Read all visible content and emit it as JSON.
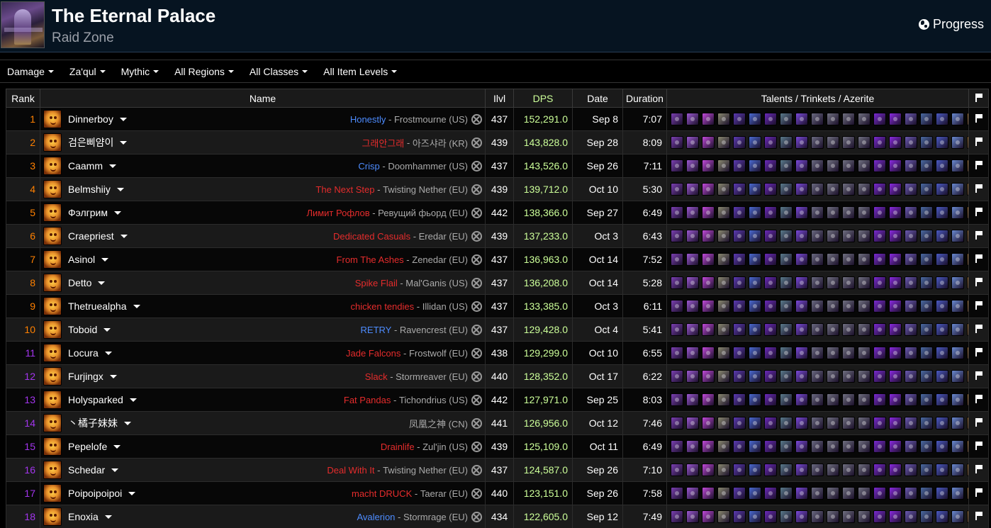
{
  "header": {
    "title": "The Eternal Palace",
    "subtitle": "Raid Zone",
    "progress_label": "Progress"
  },
  "filters": [
    {
      "label": "Damage"
    },
    {
      "label": "Za'qul"
    },
    {
      "label": "Mythic"
    },
    {
      "label": "All Regions"
    },
    {
      "label": "All Classes"
    },
    {
      "label": "All Item Levels"
    }
  ],
  "table": {
    "headers": {
      "rank": "Rank",
      "name": "Name",
      "ilvl": "Ilvl",
      "dps": "DPS",
      "date": "Date",
      "duration": "Duration",
      "talents": "Talents / Trinkets / Azerite"
    },
    "rank_colors": {
      "orange": "#ff8000",
      "purple": "#a335ee"
    },
    "guild_colors": {
      "red": "#e52c2c",
      "blue": "#4d8cff"
    },
    "rows": [
      {
        "rank": "1",
        "rank_color": "#ff8000",
        "name": "Dinnerboy",
        "guild": "Honestly",
        "guild_color": "#4d8cff",
        "realm": "Frostmourne (US)",
        "ilvl": "437",
        "dps": "152,291.0",
        "date": "Sep 8",
        "duration": "7:07"
      },
      {
        "rank": "2",
        "rank_color": "#ff8000",
        "name": "검은삐얌이",
        "guild": "그래안그래",
        "guild_color": "#e52c2c",
        "realm": "아즈샤라 (KR)",
        "ilvl": "439",
        "dps": "143,828.0",
        "date": "Sep 28",
        "duration": "8:09"
      },
      {
        "rank": "3",
        "rank_color": "#ff8000",
        "name": "Caamm",
        "guild": "Crisp",
        "guild_color": "#4d8cff",
        "realm": "Doomhammer (US)",
        "ilvl": "437",
        "dps": "143,526.0",
        "date": "Sep 26",
        "duration": "7:11"
      },
      {
        "rank": "4",
        "rank_color": "#ff8000",
        "name": "Belmshiiy",
        "guild": "The Next Step",
        "guild_color": "#e52c2c",
        "realm": "Twisting Nether (EU)",
        "ilvl": "439",
        "dps": "139,712.0",
        "date": "Oct 10",
        "duration": "5:30"
      },
      {
        "rank": "5",
        "rank_color": "#ff8000",
        "name": "Фэлгрим",
        "guild": "Лимит Рофлов",
        "guild_color": "#e52c2c",
        "realm": "Ревущий фьорд (EU)",
        "ilvl": "442",
        "dps": "138,366.0",
        "date": "Sep 27",
        "duration": "6:49"
      },
      {
        "rank": "6",
        "rank_color": "#ff8000",
        "name": "Craepriest",
        "guild": "Dedicated Casuals",
        "guild_color": "#e52c2c",
        "realm": "Eredar (EU)",
        "ilvl": "439",
        "dps": "137,233.0",
        "date": "Oct 3",
        "duration": "6:43"
      },
      {
        "rank": "7",
        "rank_color": "#ff8000",
        "name": "Asinol",
        "guild": "From The Ashes",
        "guild_color": "#e52c2c",
        "realm": "Zenedar (EU)",
        "ilvl": "437",
        "dps": "136,963.0",
        "date": "Oct 14",
        "duration": "7:52"
      },
      {
        "rank": "8",
        "rank_color": "#ff8000",
        "name": "Detto",
        "guild": "Spike Flail",
        "guild_color": "#e52c2c",
        "realm": "Mal'Ganis (US)",
        "ilvl": "437",
        "dps": "136,208.0",
        "date": "Oct 14",
        "duration": "5:28"
      },
      {
        "rank": "9",
        "rank_color": "#ff8000",
        "name": "Thetruealpha",
        "guild": "chicken tendies",
        "guild_color": "#e52c2c",
        "realm": "Illidan (US)",
        "ilvl": "437",
        "dps": "133,385.0",
        "date": "Oct 3",
        "duration": "6:11"
      },
      {
        "rank": "10",
        "rank_color": "#ff8000",
        "name": "Toboid",
        "guild": "RETRY",
        "guild_color": "#4d8cff",
        "realm": "Ravencrest (EU)",
        "ilvl": "437",
        "dps": "129,428.0",
        "date": "Oct 4",
        "duration": "5:41"
      },
      {
        "rank": "11",
        "rank_color": "#a335ee",
        "name": "Locura",
        "guild": "Jade Falcons",
        "guild_color": "#e52c2c",
        "realm": "Frostwolf (EU)",
        "ilvl": "438",
        "dps": "129,299.0",
        "date": "Oct 10",
        "duration": "6:55"
      },
      {
        "rank": "12",
        "rank_color": "#a335ee",
        "name": "Furjingx",
        "guild": "Slack",
        "guild_color": "#e52c2c",
        "realm": "Stormreaver (EU)",
        "ilvl": "440",
        "dps": "128,352.0",
        "date": "Oct 17",
        "duration": "6:22"
      },
      {
        "rank": "13",
        "rank_color": "#a335ee",
        "name": "Holysparked",
        "guild": "Fat Pandas",
        "guild_color": "#e52c2c",
        "realm": "Tichondrius (US)",
        "ilvl": "442",
        "dps": "127,971.0",
        "date": "Sep 25",
        "duration": "8:03"
      },
      {
        "rank": "14",
        "rank_color": "#a335ee",
        "name": "丶橘子妹妹",
        "guild": "",
        "guild_color": "#e52c2c",
        "realm": "凤凰之神 (CN)",
        "ilvl": "441",
        "dps": "126,956.0",
        "date": "Oct 12",
        "duration": "7:46"
      },
      {
        "rank": "15",
        "rank_color": "#a335ee",
        "name": "Pepelofe",
        "guild": "Drainlife",
        "guild_color": "#e52c2c",
        "realm": "Zul'jin (US)",
        "ilvl": "439",
        "dps": "125,109.0",
        "date": "Oct 11",
        "duration": "6:49"
      },
      {
        "rank": "16",
        "rank_color": "#a335ee",
        "name": "Schedar",
        "guild": "Deal With It",
        "guild_color": "#e52c2c",
        "realm": "Twisting Nether (EU)",
        "ilvl": "437",
        "dps": "124,587.0",
        "date": "Sep 26",
        "duration": "7:10"
      },
      {
        "rank": "17",
        "rank_color": "#a335ee",
        "name": "Poipoipoipoi",
        "guild": "macht DRUCK",
        "guild_color": "#e52c2c",
        "realm": "Taerar (EU)",
        "ilvl": "440",
        "dps": "123,151.0",
        "date": "Sep 26",
        "duration": "7:58"
      },
      {
        "rank": "18",
        "rank_color": "#a335ee",
        "name": "Enoxia",
        "guild": "Avalerion",
        "guild_color": "#4d8cff",
        "realm": "Stormrage (EU)",
        "ilvl": "434",
        "dps": "122,605.0",
        "date": "Sep 12",
        "duration": "7:49"
      }
    ],
    "icon_palette": [
      "#7a3fb0",
      "#9b59d0",
      "#c04ad8",
      "#8a8a70",
      "#5a3ab0",
      "#4a6ad0",
      "#6a2ab8",
      "#5a7a8a",
      "#7a4ad8",
      "#6a6a80",
      "#707080",
      "#707080",
      "#707080",
      "#7a2ad0",
      "#8a2ae0",
      "#6a5ab0",
      "#4a6aa0",
      "#4a5ac0",
      "#6a8ad0",
      "#b08040"
    ],
    "icon_names": [
      "talent-icon",
      "talent-icon",
      "talent-icon",
      "talent-icon",
      "talent-icon",
      "talent-icon",
      "talent-icon",
      "talent-icon",
      "talent-icon",
      "trinket-icon",
      "trinket-icon",
      "azerite-icon",
      "azerite-icon",
      "azerite-icon",
      "azerite-icon",
      "azerite-icon",
      "azerite-icon",
      "azerite-icon",
      "azerite-icon",
      "azerite-icon"
    ]
  }
}
